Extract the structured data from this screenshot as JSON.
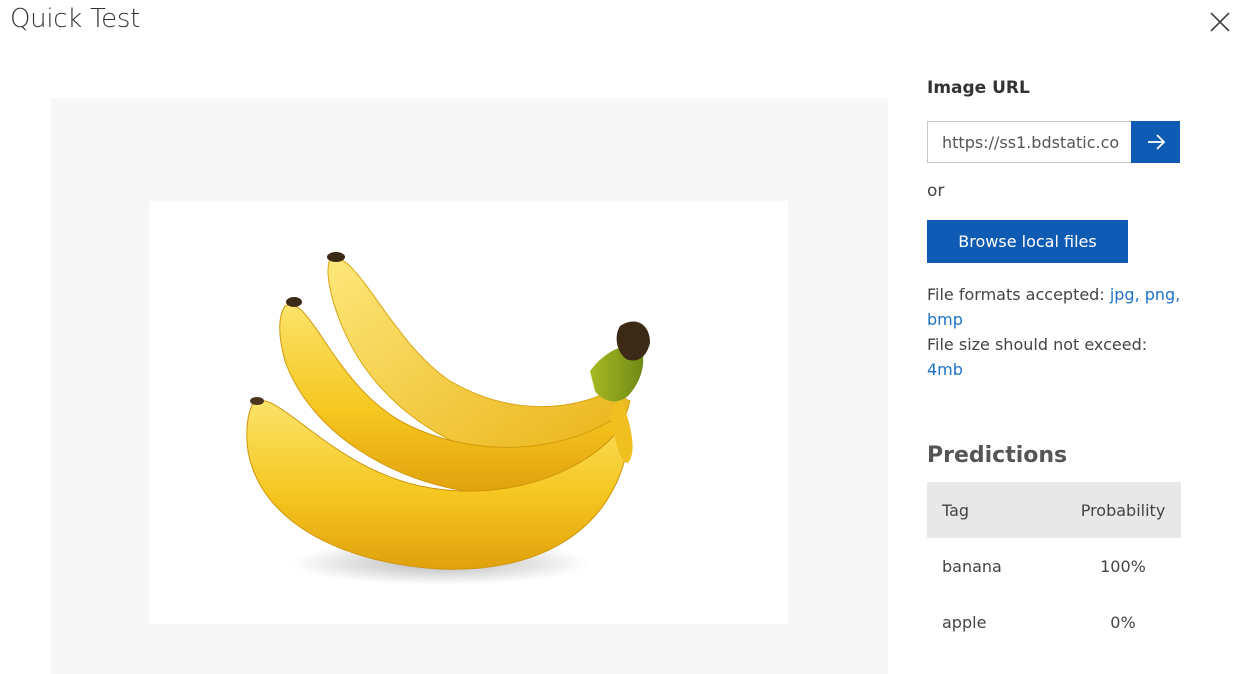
{
  "dialog": {
    "title": "Quick Test",
    "close_icon": "close-icon"
  },
  "preview": {
    "image_subject": "banana-bunch-image",
    "accent_color": "#f5c518"
  },
  "image_url": {
    "label": "Image URL",
    "value": "https://ss1.bdstatic.co",
    "submit_icon": "arrow-right-icon"
  },
  "or_text": "or",
  "browse": {
    "label": "Browse local files"
  },
  "info": {
    "formats_prefix": "File formats accepted:",
    "formats_link": "jpg, png, bmp",
    "size_prefix": "File size should not exceed:",
    "size_link": "4mb"
  },
  "predictions": {
    "heading": "Predictions",
    "columns": [
      "Tag",
      "Probability"
    ],
    "rows": [
      {
        "tag": "banana",
        "probability": "100%"
      },
      {
        "tag": "apple",
        "probability": "0%"
      }
    ]
  },
  "colors": {
    "primary": "#0f5bb4",
    "link": "#1f72c7",
    "preview_bg": "#f7f7f7",
    "header_bg": "#e8e8e8"
  }
}
